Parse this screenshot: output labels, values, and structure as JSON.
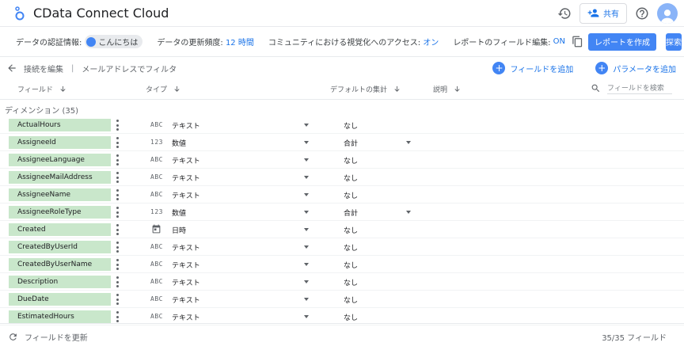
{
  "app": {
    "title": "CData Connect Cloud"
  },
  "topbar": {
    "share_label": "共有"
  },
  "infobar": {
    "credentials_label": "データの認証情報:",
    "credentials_user": "こんにちは",
    "freshness_label": "データの更新頻度:",
    "freshness_value": "12 時間",
    "community_label": "コミュニティにおける視覚化へのアクセス:",
    "community_value": "オン",
    "field_edit_label": "レポートのフィールド編集:",
    "field_edit_value": "ON",
    "create_report": "レポートを作成",
    "explore": "探索"
  },
  "nav": {
    "edit_connection": "接続を編集",
    "divider": "|",
    "filter_by_email": "メールアドレスでフィルタ",
    "add_field": "フィールドを追加",
    "add_parameter": "パラメータを追加"
  },
  "columns": {
    "field": "フィールド",
    "type": "タイプ",
    "default_agg": "デフォルトの集計",
    "description": "説明",
    "search_placeholder": "フィールドを検索"
  },
  "section": {
    "label": "ディメンション (35)"
  },
  "fields": [
    {
      "name": "ActualHours",
      "type_icon": "ABC",
      "type": "テキスト",
      "agg": "なし"
    },
    {
      "name": "AssigneeId",
      "type_icon": "123",
      "type": "数値",
      "agg": "合計"
    },
    {
      "name": "AssigneeLanguage",
      "type_icon": "ABC",
      "type": "テキスト",
      "agg": "なし"
    },
    {
      "name": "AssigneeMailAddress",
      "type_icon": "ABC",
      "type": "テキスト",
      "agg": "なし"
    },
    {
      "name": "AssigneeName",
      "type_icon": "ABC",
      "type": "テキスト",
      "agg": "なし"
    },
    {
      "name": "AssigneeRoleType",
      "type_icon": "123",
      "type": "数値",
      "agg": "合計"
    },
    {
      "name": "Created",
      "type_icon": "calendar-icon",
      "type": "日時",
      "agg": "なし"
    },
    {
      "name": "CreatedByUserId",
      "type_icon": "ABC",
      "type": "テキスト",
      "agg": "なし"
    },
    {
      "name": "CreatedByUserName",
      "type_icon": "ABC",
      "type": "テキスト",
      "agg": "なし"
    },
    {
      "name": "Description",
      "type_icon": "ABC",
      "type": "テキスト",
      "agg": "なし"
    },
    {
      "name": "DueDate",
      "type_icon": "ABC",
      "type": "テキスト",
      "agg": "なし"
    },
    {
      "name": "EstimatedHours",
      "type_icon": "ABC",
      "type": "テキスト",
      "agg": "なし"
    }
  ],
  "footer": {
    "refresh": "フィールドを更新",
    "count": "35/35 フィールド"
  },
  "colors": {
    "accent": "#4285f4",
    "field_chip": "#c9e7cb",
    "link": "#1a73e8"
  }
}
